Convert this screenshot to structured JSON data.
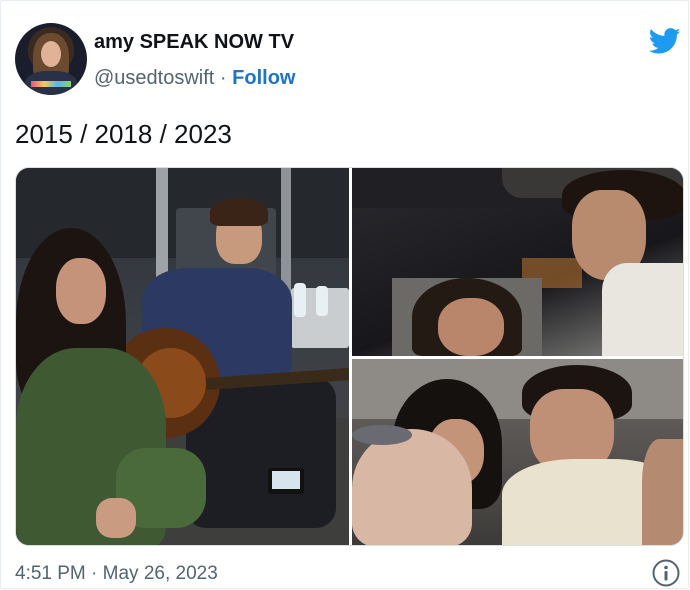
{
  "tweet": {
    "display_name": "amy SPEAK NOW TV",
    "handle": "@usedtoswift",
    "separator": "·",
    "follow_label": "Follow",
    "text": "2015 / 2018 / 2023",
    "timestamp": "4:51 PM · May 26, 2023",
    "icons": {
      "brand": "twitter-bird-icon",
      "info": "info-icon"
    },
    "colors": {
      "follow": "#1d74c8",
      "bird": "#1d9bf0",
      "secondary_text": "#536471"
    }
  }
}
